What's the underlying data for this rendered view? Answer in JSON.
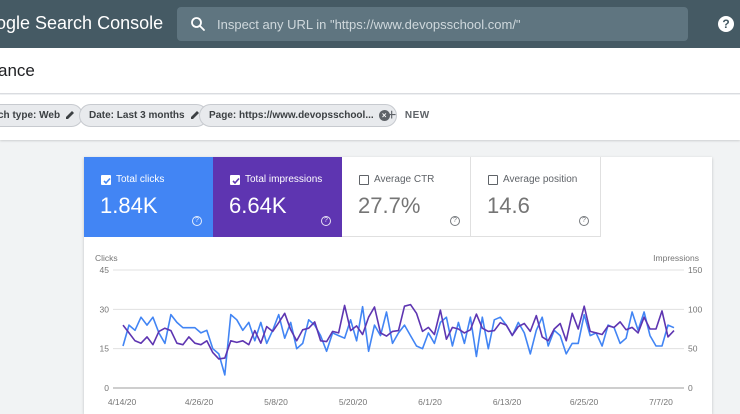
{
  "header": {
    "app_title": "ogle Search Console",
    "search_placeholder": "Inspect any URL in \"https://www.devopsschool.com/\"",
    "help_label": "?"
  },
  "page": {
    "title": "ance"
  },
  "filters": {
    "chips": [
      {
        "label": "ch type: Web"
      },
      {
        "label": "Date: Last 3 months"
      },
      {
        "label": "Page: https://www.devopsschool..."
      }
    ],
    "new_label": "NEW"
  },
  "metrics": [
    {
      "label": "Total clicks",
      "value": "1.84K",
      "checked": true,
      "color": "#4285f4"
    },
    {
      "label": "Total impressions",
      "value": "6.64K",
      "checked": true,
      "color": "#5e35b1"
    },
    {
      "label": "Average CTR",
      "value": "27.7%",
      "checked": false
    },
    {
      "label": "Average position",
      "value": "14.6",
      "checked": false
    }
  ],
  "chart_data": {
    "type": "line",
    "left_axis_label": "Clicks",
    "right_axis_label": "Impressions",
    "left_ticks": [
      "45",
      "30",
      "15",
      "0"
    ],
    "right_ticks": [
      "150",
      "100",
      "50",
      "0"
    ],
    "ylim_left": [
      0,
      45
    ],
    "ylim_right": [
      0,
      150
    ],
    "x_tick_labels": [
      "4/14/20",
      "4/26/20",
      "5/8/20",
      "5/20/20",
      "6/1/20",
      "6/13/20",
      "6/25/20",
      "7/7/20"
    ],
    "series": [
      {
        "name": "Clicks",
        "color": "#4285f4",
        "axis": "left",
        "values": [
          16,
          24,
          22,
          27,
          24,
          27,
          21,
          17,
          28,
          25,
          23,
          23,
          23,
          21,
          22,
          15,
          13,
          5,
          28,
          26,
          22,
          25,
          18,
          25,
          17,
          22,
          28,
          19,
          25,
          15,
          17,
          26,
          24,
          20,
          14,
          21,
          20,
          19,
          26,
          18,
          31,
          14,
          24,
          20,
          29,
          17,
          21,
          24,
          20,
          16,
          15,
          21,
          17,
          25,
          27,
          16,
          25,
          17,
          27,
          12,
          27,
          15,
          26,
          27,
          24,
          20,
          25,
          21,
          13,
          22,
          27,
          16,
          22,
          20,
          13,
          17,
          17,
          28,
          20,
          21,
          16,
          24,
          23,
          17,
          19,
          29,
          22,
          29,
          20,
          16,
          16,
          24,
          23
        ]
      },
      {
        "name": "Impressions",
        "color": "#5e35b1",
        "axis": "right",
        "values": [
          80,
          70,
          60,
          57,
          65,
          55,
          72,
          76,
          73,
          57,
          55,
          65,
          57,
          55,
          60,
          45,
          37,
          38,
          60,
          58,
          60,
          55,
          73,
          57,
          78,
          72,
          83,
          95,
          74,
          60,
          74,
          76,
          84,
          60,
          59,
          72,
          70,
          105,
          73,
          79,
          68,
          90,
          103,
          70,
          66,
          72,
          73,
          104,
          106,
          95,
          72,
          77,
          68,
          99,
          62,
          77,
          75,
          70,
          74,
          94,
          76,
          72,
          73,
          83,
          80,
          67,
          78,
          82,
          72,
          92,
          65,
          60,
          75,
          82,
          60,
          95,
          75,
          104,
          72,
          70,
          68,
          79,
          77,
          84,
          74,
          77,
          70,
          90,
          75,
          75,
          98,
          65,
          73
        ]
      }
    ]
  }
}
